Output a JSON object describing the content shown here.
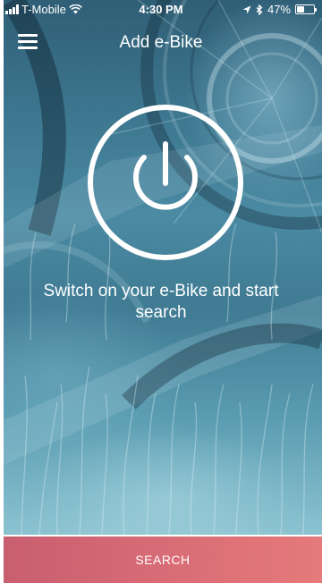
{
  "status_bar": {
    "carrier": "T-Mobile",
    "time": "4:30 PM",
    "battery": "47%",
    "battery_level": 0.47,
    "icons": [
      "signal-icon",
      "wifi-icon",
      "location-icon",
      "bluetooth-icon",
      "battery-icon"
    ]
  },
  "nav": {
    "title": "Add e-Bike",
    "menu_icon": "hamburger-menu-icon"
  },
  "main": {
    "power_icon": "power-icon",
    "message": "Switch on your e-Bike and start search"
  },
  "actions": {
    "search_label": "SEARCH"
  },
  "colors": {
    "button_gradient_start": "#c85f6f",
    "button_gradient_end": "#e57a7b",
    "background_tint": "#4a8aa2",
    "foreground": "#ffffff"
  }
}
